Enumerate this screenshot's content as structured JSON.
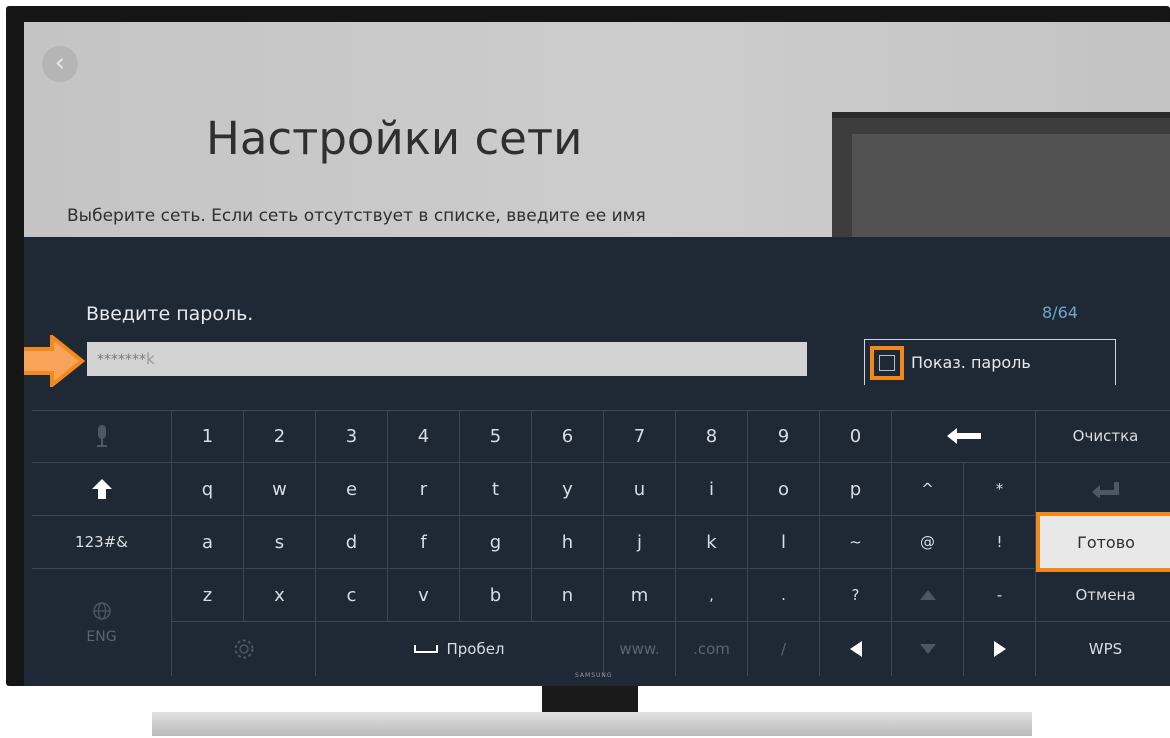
{
  "page": {
    "title": "Настройки сети",
    "description": "Выберите сеть. Если сеть отсутствует в списке, введите ее имя"
  },
  "password": {
    "prompt": "Введите пароль.",
    "counter": "8/64",
    "masked_value": "*******",
    "last_char": "k",
    "show_password_label": "Показ. пароль"
  },
  "keyboard": {
    "row1": [
      "1",
      "2",
      "3",
      "4",
      "5",
      "6",
      "7",
      "8",
      "9",
      "0"
    ],
    "clear_label": "Очистка",
    "row2": [
      "q",
      "w",
      "e",
      "r",
      "t",
      "y",
      "u",
      "i",
      "o",
      "p",
      "^",
      "*"
    ],
    "symbols_label": "123#&",
    "row3": [
      "a",
      "s",
      "d",
      "f",
      "g",
      "h",
      "j",
      "k",
      "l",
      "~",
      "@",
      "!"
    ],
    "done_label": "Готово",
    "row4": [
      "z",
      "x",
      "c",
      "v",
      "b",
      "n",
      "m",
      ",",
      ".",
      "?"
    ],
    "dash_label": "-",
    "cancel_label": "Отмена",
    "lang_label": "ENG",
    "space_label": "Пробел",
    "www_label": "www.",
    "com_label": ".com",
    "slash_label": "/",
    "wps_label": "WPS"
  },
  "accent_color": "#f08a1c",
  "brand": "SAMSUNG"
}
